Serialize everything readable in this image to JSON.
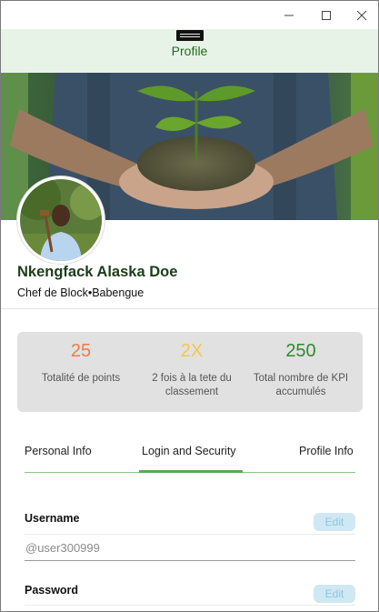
{
  "window": {
    "controls": {
      "minimize": "minimize-icon",
      "maximize": "maximize-icon",
      "close": "close-icon"
    }
  },
  "header": {
    "menu_icon": "hamburger-menu-icon",
    "title": "Profile"
  },
  "profile": {
    "name": "Nkengfack Alaska Doe",
    "role": "Chef de Block•Babengue"
  },
  "stats": [
    {
      "value": "25",
      "label": "Totalité de points",
      "color": "#f07a4a"
    },
    {
      "value": "2X",
      "label": "2 fois à la tete du classement",
      "color": "#f5c64a"
    },
    {
      "value": "250",
      "label": "Total nombre de KPI accumulés",
      "color": "#2e8b2e"
    }
  ],
  "tabs": [
    {
      "label": "Personal Info",
      "active": false
    },
    {
      "label": "Login and Security",
      "active": true
    },
    {
      "label": "Profile Info",
      "active": false
    }
  ],
  "form": {
    "username": {
      "label": "Username",
      "placeholder": "@user300999",
      "value": "",
      "edit_label": "Edit"
    },
    "password": {
      "label": "Password",
      "value": "",
      "edit_label": "Edit"
    }
  },
  "colors": {
    "accent_green": "#5aa75a",
    "header_bg": "#e8f3e8",
    "title_green": "#1e6b1e",
    "edit_bg": "#cfe8f3",
    "edit_text": "#8ec6e0"
  }
}
